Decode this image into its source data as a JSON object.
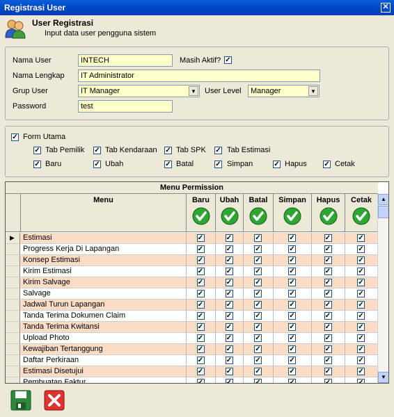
{
  "window": {
    "title": "Registrasi User"
  },
  "header": {
    "title": "User Registrasi",
    "subtitle": "Input data user pengguna sistem"
  },
  "form": {
    "nama_user_label": "Nama User",
    "nama_user_value": "INTECH",
    "masih_aktif_label": "Masih Aktif?",
    "masih_aktif_checked": true,
    "nama_lengkap_label": "Nama Lengkap",
    "nama_lengkap_value": "IT Administrator",
    "grup_user_label": "Grup User",
    "grup_user_value": "IT Manager",
    "user_level_label": "User Level",
    "user_level_value": "Manager",
    "password_label": "Password",
    "password_value": "test"
  },
  "permissions": {
    "form_utama": "Form Utama",
    "tabs": [
      "Tab Pemilik",
      "Tab Kendaraan",
      "Tab SPK",
      "Tab Estimasi"
    ],
    "actions": [
      "Baru",
      "Ubah",
      "Batal",
      "Simpan",
      "Hapus",
      "Cetak"
    ]
  },
  "grid": {
    "title": "Menu Permission",
    "menu_header": "Menu",
    "columns": [
      "Baru",
      "Ubah",
      "Batal",
      "Simpan",
      "Hapus",
      "Cetak"
    ],
    "rows": [
      "Estimasi",
      "Progress Kerja Di Lapangan",
      "Konsep Estimasi",
      "Kirim Estimasi",
      "Kirim Salvage",
      "Salvage",
      "Jadwal Turun Lapangan",
      "Tanda Terima Dokumen Claim",
      "Tanda Terima Kwitansi",
      "Upload Photo",
      "Kewajiban Tertanggung",
      "Daftar Perkiraan",
      "Estimasi Disetujui",
      "Pembuatan Faktur"
    ]
  },
  "colors": {
    "row_alt": "#FBDCC5",
    "row_plain": "#FFFFFF",
    "field_bg": "#FFFFC8"
  }
}
